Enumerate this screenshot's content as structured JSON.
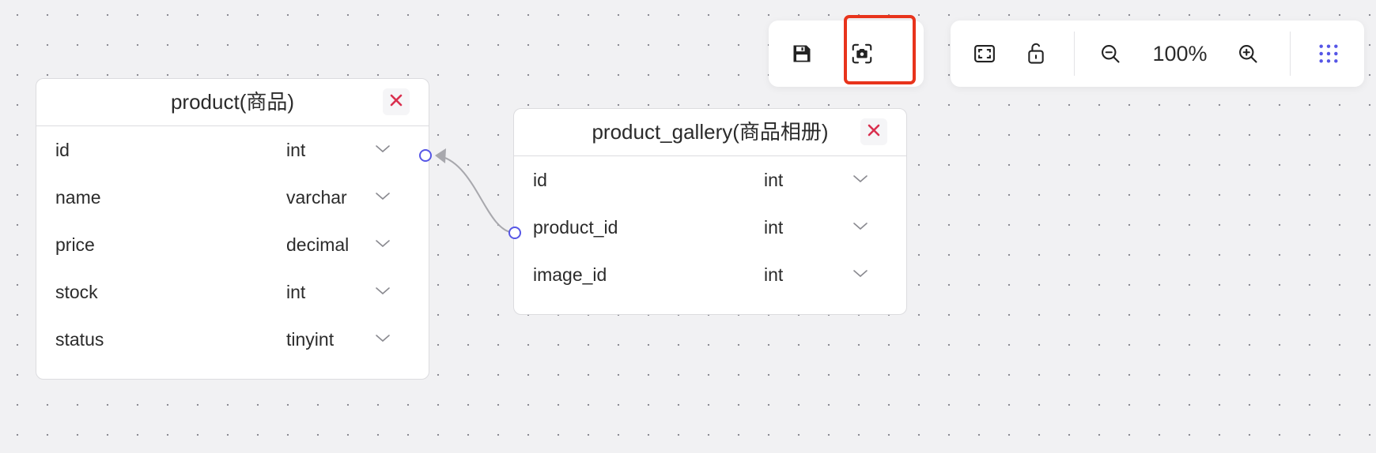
{
  "toolbar": {
    "save_icon": "save-icon",
    "screenshot_icon": "camera-icon",
    "fit_icon": "fit-screen-icon",
    "lock_icon": "unlock-icon",
    "zoom_out_icon": "zoom-out-icon",
    "zoom_level": "100%",
    "zoom_in_icon": "zoom-in-icon",
    "grid_icon": "grid-dots-icon",
    "highlight_color": "#e8341c"
  },
  "tables": {
    "product": {
      "title": "product(商品)",
      "fields": [
        {
          "name": "id",
          "type": "int"
        },
        {
          "name": "name",
          "type": "varchar"
        },
        {
          "name": "price",
          "type": "decimal"
        },
        {
          "name": "stock",
          "type": "int"
        },
        {
          "name": "status",
          "type": "tinyint"
        }
      ]
    },
    "product_gallery": {
      "title": "product_gallery(商品相册)",
      "fields": [
        {
          "name": "id",
          "type": "int"
        },
        {
          "name": "product_id",
          "type": "int"
        },
        {
          "name": "image_id",
          "type": "int"
        }
      ]
    }
  },
  "relation": {
    "from": "product_gallery.product_id",
    "to": "product.id"
  },
  "colors": {
    "close": "#d9304f",
    "port": "#5656e6",
    "grid_icon": "#5656e6",
    "connector": "#a8a8ad"
  }
}
